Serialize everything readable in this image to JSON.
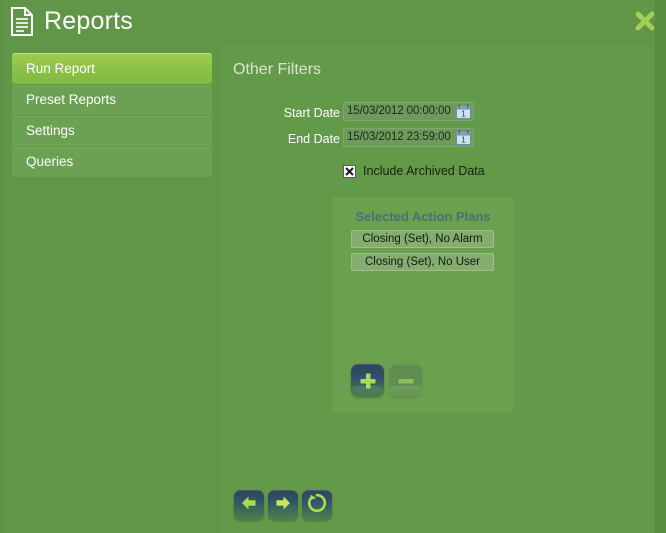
{
  "window": {
    "title": "Reports",
    "title_icon": "document-icon",
    "close_icon": "close-x-icon",
    "accent_active": "#8cc247",
    "background": "#619548",
    "panel_background": "#639a49"
  },
  "sidebar": {
    "items": [
      {
        "label": "Run Report",
        "active": true
      },
      {
        "label": "Preset Reports",
        "active": false
      },
      {
        "label": "Settings",
        "active": false
      },
      {
        "label": "Queries",
        "active": false
      }
    ]
  },
  "main": {
    "section_title": "Other Filters",
    "fields": [
      {
        "label": "Start Date",
        "value": "15/03/2012 00:00:00",
        "icon": "calendar-icon"
      },
      {
        "label": "End Date",
        "value": "15/03/2012 23:59:00",
        "icon": "calendar-icon"
      }
    ],
    "checkbox": {
      "label": "Include Archived Data",
      "checked": true,
      "mark": "x"
    },
    "action_plans": {
      "title": "Selected Action Plans",
      "items": [
        "Closing (Set), No Alarm",
        "Closing (Set), No User"
      ],
      "add_button": {
        "icon": "plus-icon",
        "label": "Add"
      },
      "remove_button": {
        "icon": "minus-icon",
        "label": "Remove"
      }
    }
  },
  "footer": {
    "buttons": [
      {
        "icon": "arrow-left-icon",
        "label": "Back"
      },
      {
        "icon": "arrow-right-icon",
        "label": "Next"
      },
      {
        "icon": "refresh-icon",
        "label": "Refresh"
      }
    ]
  }
}
